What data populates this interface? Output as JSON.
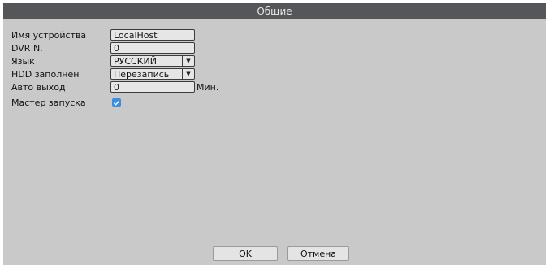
{
  "window": {
    "title": "Общие"
  },
  "settings": {
    "device_name": {
      "label": "Имя устройства",
      "value": "LocalHost"
    },
    "dvr_no": {
      "label": "DVR N.",
      "value": "0"
    },
    "language": {
      "label": "Язык",
      "value": "РУССКИЙ"
    },
    "hdd_full": {
      "label": "HDD заполнен",
      "value": "Перезапись"
    },
    "auto_logout": {
      "label": "Авто выход",
      "value": "0",
      "unit": "Мин."
    },
    "startup_wizard": {
      "label": "Мастер запуска",
      "checked": true
    }
  },
  "buttons": {
    "ok": "OK",
    "cancel": "Отмена"
  },
  "colors": {
    "titlebar": "#55565a",
    "panel": "#c9c9c9",
    "checkbox": "#3a8ee0"
  },
  "icons": {
    "dropdown": "chevron-down-icon",
    "check": "check-icon"
  }
}
